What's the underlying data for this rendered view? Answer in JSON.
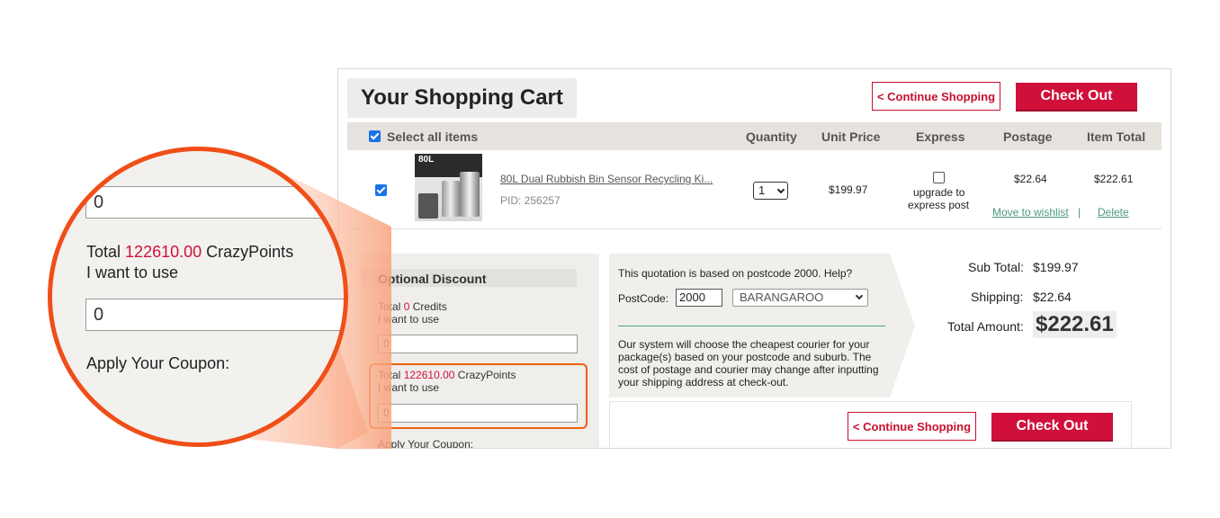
{
  "header": {
    "title": "Your Shopping Cart",
    "continue_label": "< Continue Shopping",
    "checkout_label": "Check Out"
  },
  "table": {
    "select_all": "Select all items",
    "columns": [
      "Quantity",
      "Unit Price",
      "Express",
      "Postage",
      "Item Total"
    ]
  },
  "item": {
    "name": "80L Dual Rubbish Bin Sensor Recycling Ki...",
    "pid": "PID: 256257",
    "thumb_text": "80L",
    "quantity": "1",
    "unit_price": "$199.97",
    "express_line1": "upgrade to",
    "express_line2": "express post",
    "postage": "$22.64",
    "item_total": "$222.61",
    "wishlist": "Move to wishlist",
    "separator": "|",
    "delete": "Delete"
  },
  "discount": {
    "title": "Optional Discount",
    "total_word": "Total",
    "credits_value": "0",
    "credits_label": "Credits",
    "use_label": "I want to use",
    "credits_input": "0",
    "points_value": "122610.00",
    "points_label": "CrazyPoints",
    "points_input": "0",
    "coupon_label": "Apply Your Coupon:"
  },
  "quote": {
    "intro": "This quotation is based on postcode 2000. Help?",
    "postcode_label": "PostCode:",
    "postcode_value": "2000",
    "suburb": "BARANGAROO",
    "note": "Our system will choose the cheapest courier for your package(s) based on your postcode and suburb. The cost of postage and courier may change after inputting your shipping address at check-out."
  },
  "totals": {
    "sub_label": "Sub Total:",
    "sub_value": "$199.97",
    "ship_label": "Shipping:",
    "ship_value": "$22.64",
    "amount_label": "Total Amount:",
    "amount_value": "$222.61"
  },
  "magnifier": {
    "top_input": "0",
    "total_word": "Total",
    "points_value": "122610.00",
    "points_label": "CrazyPoints",
    "use_label": "I want to use",
    "points_input": "0",
    "coupon_label": "Apply Your Coupon:"
  },
  "colors": {
    "accent": "#d0103a",
    "highlight": "#f04e18",
    "link_green": "#4a9a7a"
  }
}
